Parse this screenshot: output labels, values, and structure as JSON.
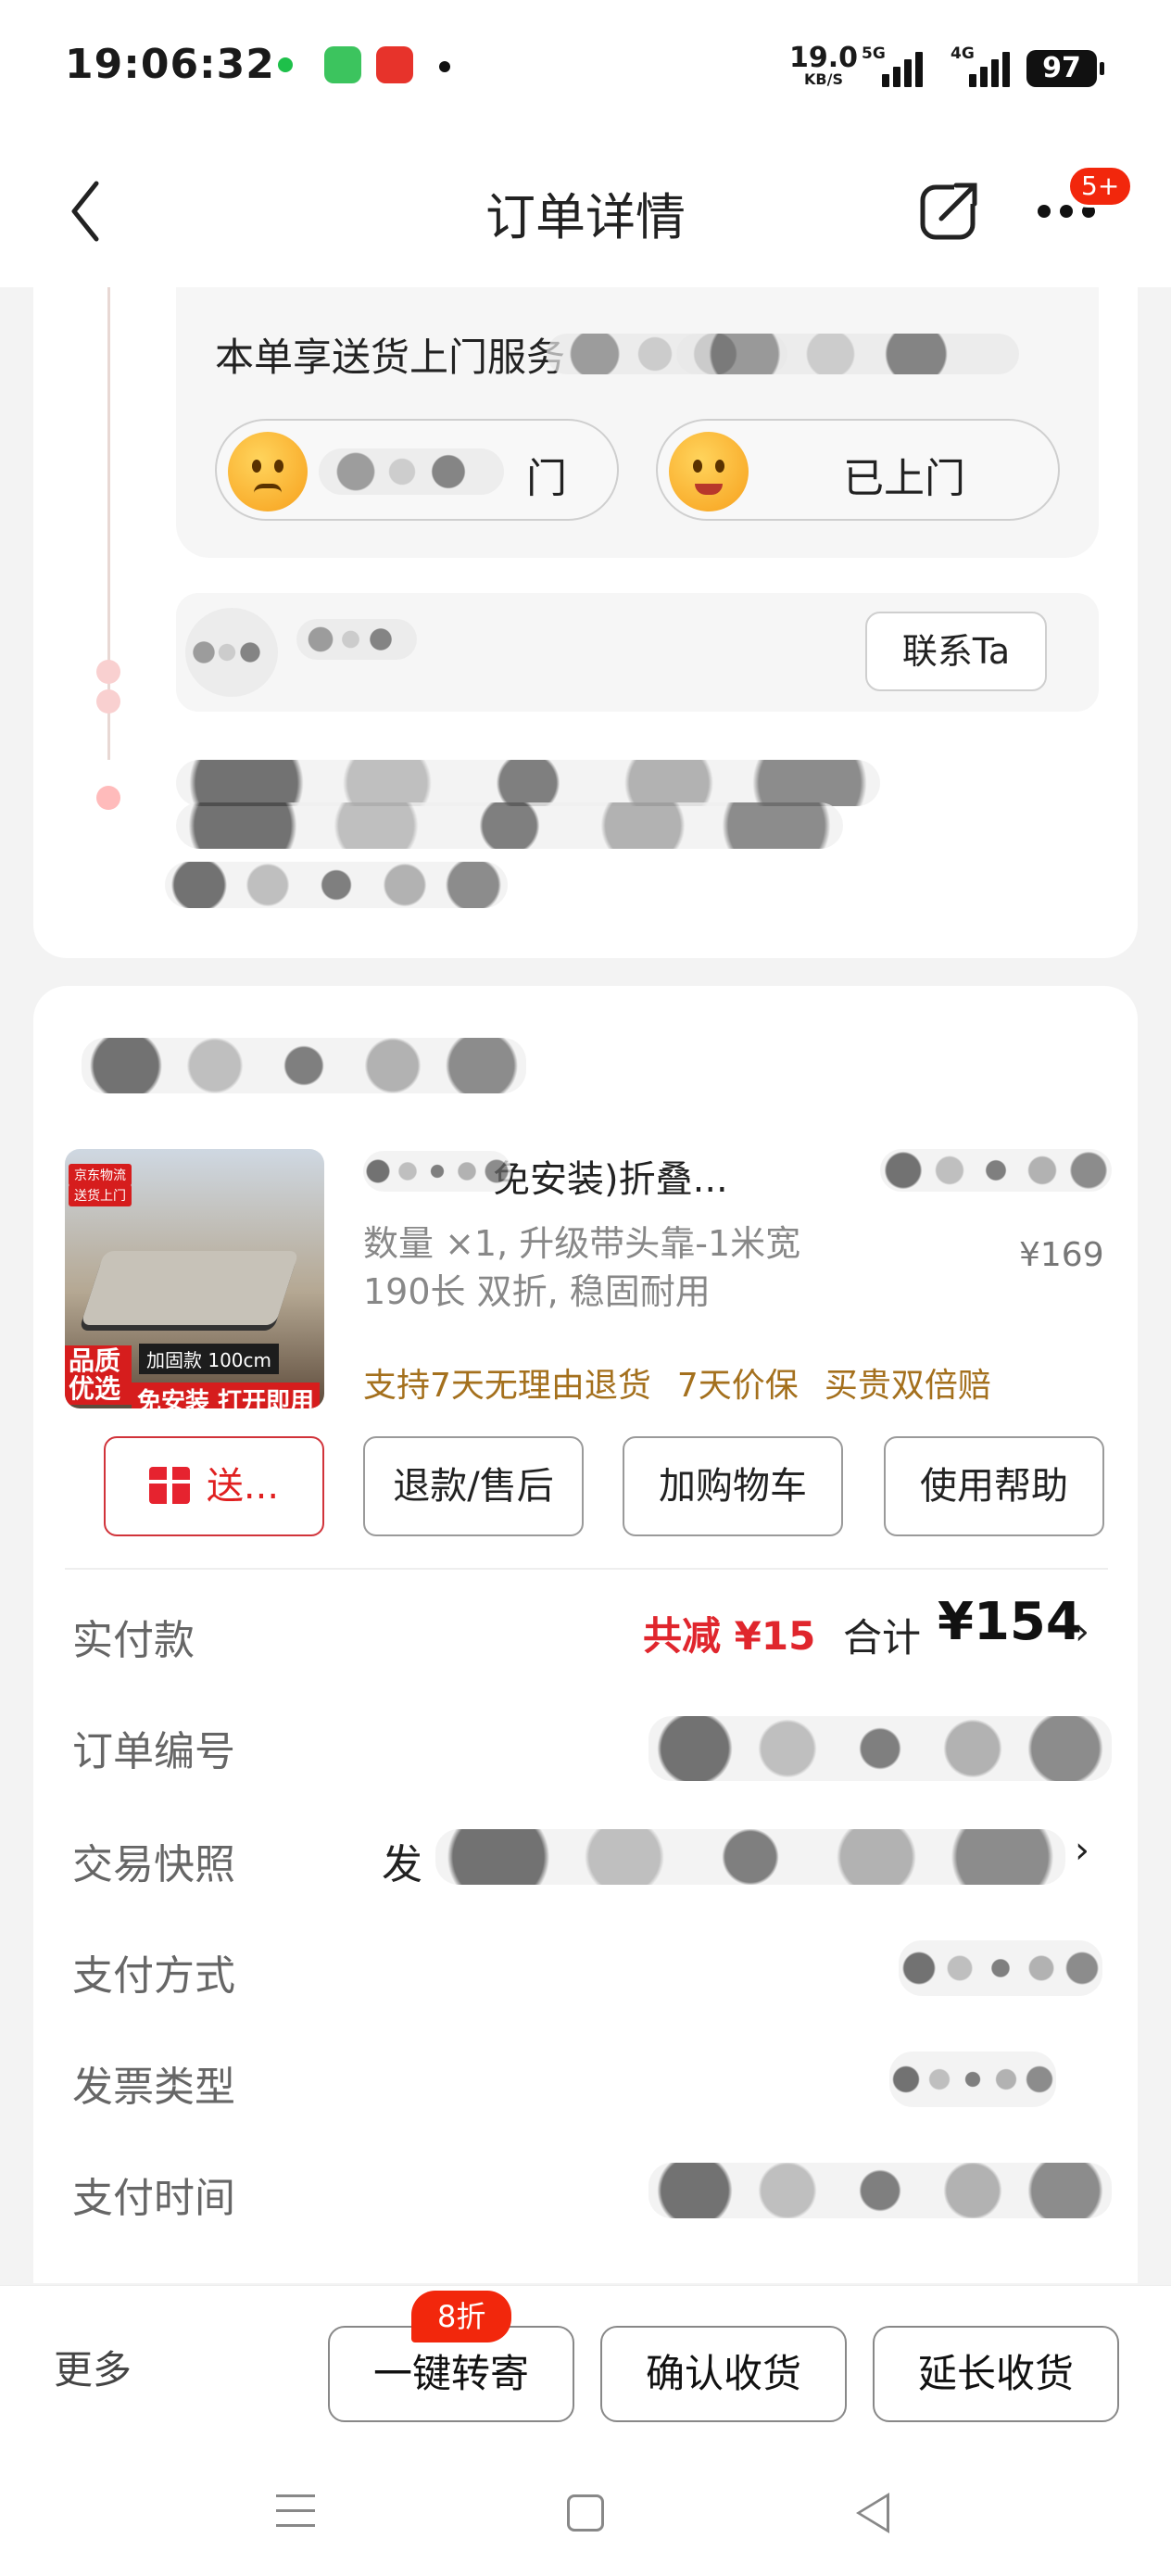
{
  "status_bar": {
    "time": "19:06:32",
    "net_speed_value": "19.0",
    "net_speed_unit": "KB/S",
    "sig1_label": "5G",
    "sig2_label": "4G",
    "battery": "97"
  },
  "nav": {
    "title": "订单详情",
    "badge": "5+"
  },
  "service": {
    "text": "本单享送货上门服务",
    "option_not_home_label": "门",
    "option_home_label": "已上门"
  },
  "courier": {
    "contact_label": "联系Ta"
  },
  "product": {
    "title_fragment": "免安装)折叠...",
    "spec": "数量 ×1, 升级带头靠-1米宽 190长 双折, 稳固耐用",
    "price": "¥169",
    "tags": [
      "支持7天无理由退货",
      "7天价保",
      "买贵双倍赔"
    ],
    "image_badges": {
      "tag1": "京东物流",
      "tag2": "送货上门",
      "size": "加固款 100cm",
      "quality": "品质优选",
      "install": "免安装 打开即用"
    }
  },
  "actions": {
    "gift": "送...",
    "refund": "退款/售后",
    "add_cart": "加购物车",
    "help": "使用帮助"
  },
  "info": {
    "paid_label": "实付款",
    "discount": "共减 ¥15",
    "total_label": "合计",
    "total": "¥154",
    "order_no_label": "订单编号",
    "snapshot_label": "交易快照",
    "snapshot_prefix": "发",
    "pay_method_label": "支付方式",
    "invoice_label": "发票类型",
    "pay_time_label": "支付时间"
  },
  "bottom": {
    "more": "更多",
    "forward_badge": "8折",
    "forward": "一键转寄",
    "confirm": "确认收货",
    "extend": "延长收货"
  }
}
